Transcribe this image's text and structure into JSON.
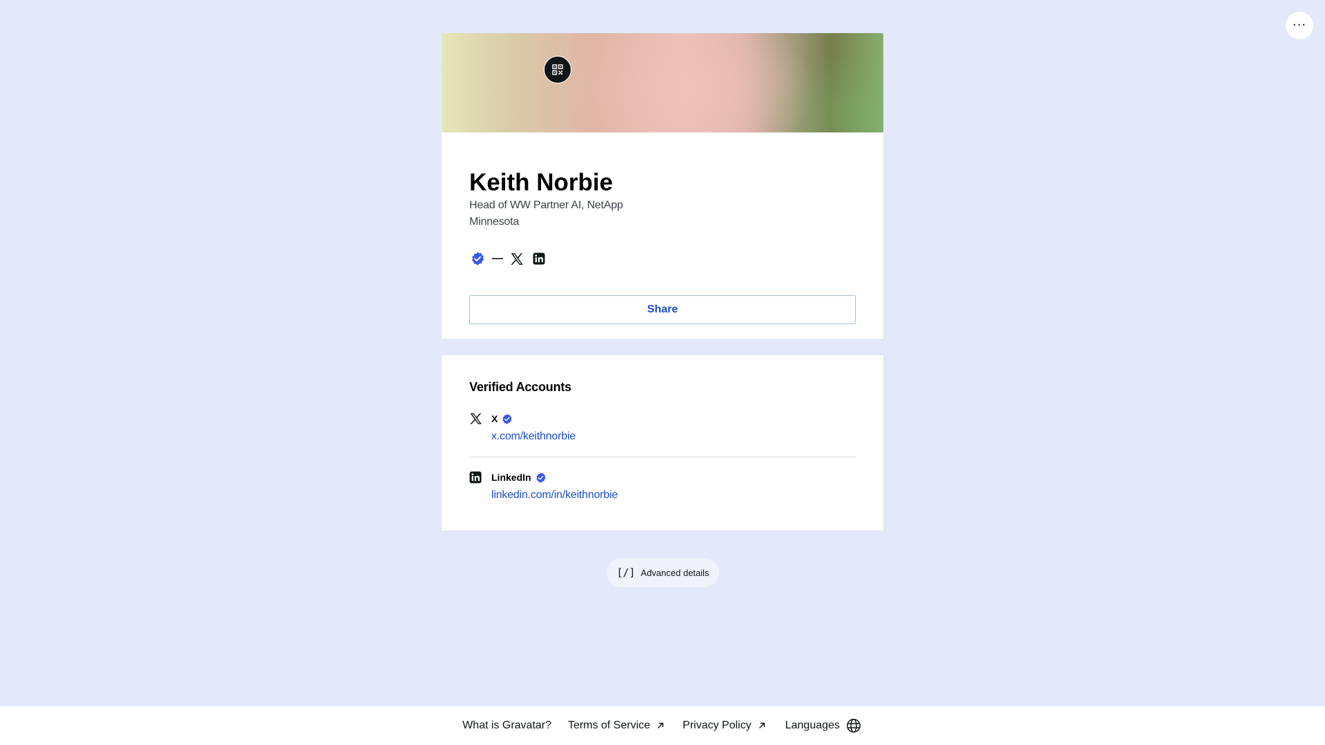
{
  "top_menu": {
    "more_label": "···"
  },
  "profile": {
    "name": "Keith Norbie",
    "job_title": "Head of WW Partner AI, NetApp",
    "location": "Minnesota",
    "share_label": "Share",
    "icons": [
      "verified-icon",
      "dash-icon",
      "x-icon",
      "linkedin-icon"
    ]
  },
  "verified_accounts": {
    "title": "Verified Accounts",
    "accounts": [
      {
        "name": "X",
        "url": "x.com/keithnorbie",
        "icon": "x-icon"
      },
      {
        "name": "LinkedIn",
        "url": "linkedin.com/in/keithnorbie",
        "icon": "linkedin-icon"
      }
    ]
  },
  "advanced": {
    "glyph": "[/]",
    "label": "Advanced details"
  },
  "footer": {
    "what_is": "What is Gravatar?",
    "terms": "Terms of Service",
    "privacy": "Privacy Policy",
    "languages": "Languages"
  },
  "colors": {
    "background": "#e3e9fb",
    "link": "#1d4fc4",
    "verified": "#3858e9",
    "text": "#101517"
  }
}
